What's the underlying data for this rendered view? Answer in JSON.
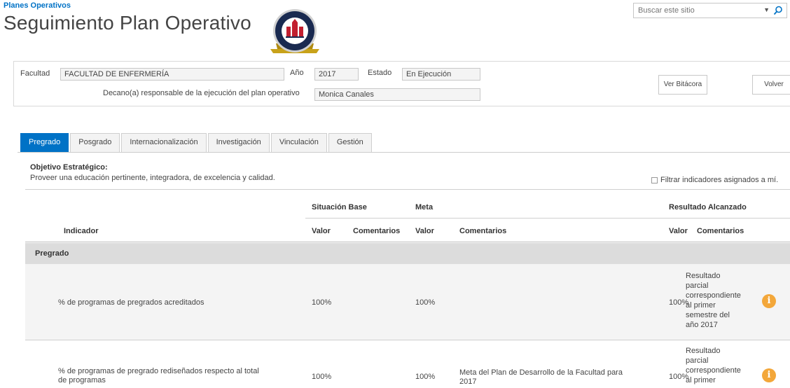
{
  "header": {
    "site_link": "Planes Operativos",
    "page_title": "Seguimiento Plan Operativo",
    "search_placeholder": "Buscar este sitio"
  },
  "info": {
    "facultad_label": "Facultad",
    "facultad_value": "FACULTAD DE ENFERMERÍA",
    "anio_label": "Año",
    "anio_value": "2017",
    "estado_label": "Estado",
    "estado_value": "En Ejecución",
    "decano_label": "Decano(a) responsable de la ejecución del plan operativo",
    "decano_value": "Monica Canales",
    "ver_bitacora": "Ver Bitácora",
    "volver": "Volver"
  },
  "tabs": [
    {
      "label": "Pregrado",
      "active": true
    },
    {
      "label": "Posgrado",
      "active": false
    },
    {
      "label": "Internacionalización",
      "active": false
    },
    {
      "label": "Investigación",
      "active": false
    },
    {
      "label": "Vinculación",
      "active": false
    },
    {
      "label": "Gestión",
      "active": false
    }
  ],
  "objective": {
    "title": "Objetivo Estratégico:",
    "text": "Proveer una educación pertinente, integradora, de excelencia y calidad."
  },
  "filter_label": "Filtrar indicadores asignados a mí.",
  "table": {
    "group_headers": {
      "situacion_base": "Situación Base",
      "meta": "Meta",
      "resultado": "Resultado Alcanzado"
    },
    "col_headers": {
      "indicador": "Indicador",
      "valor_base": "Valor",
      "comentarios_base": "Comentarios",
      "valor_meta": "Valor",
      "comentarios_meta": "Comentarios",
      "valor_res": "Valor",
      "comentarios_res": "Comentarios"
    },
    "group_row": "Pregrado",
    "rows": [
      {
        "indicador": "% de programas de pregrados acreditados",
        "base_valor": "100%",
        "base_comentarios": "",
        "meta_valor": "100%",
        "meta_comentarios": "",
        "res_valor": "100%",
        "res_comentarios": [
          "Resultado",
          "parcial",
          "correspondiente",
          "al primer",
          "semestre del",
          "año 2017"
        ]
      },
      {
        "indicador": [
          "% de programas de pregrado rediseñados respecto al total",
          "de programas"
        ],
        "base_valor": "100%",
        "base_comentarios": "",
        "meta_valor": "100%",
        "meta_comentarios": [
          "Meta del Plan de Desarrollo de la Facultad para",
          "2017"
        ],
        "res_valor": "100%",
        "res_comentarios": [
          "Resultado",
          "parcial",
          "correspondiente",
          "al primer"
        ]
      }
    ]
  },
  "colors": {
    "accent": "#0072c6",
    "info_icon": "#f3a73a",
    "group_row_bg": "#dcdcdc"
  },
  "icons": {
    "logo": "university-logo",
    "search": "search-icon",
    "info": "info-icon"
  }
}
